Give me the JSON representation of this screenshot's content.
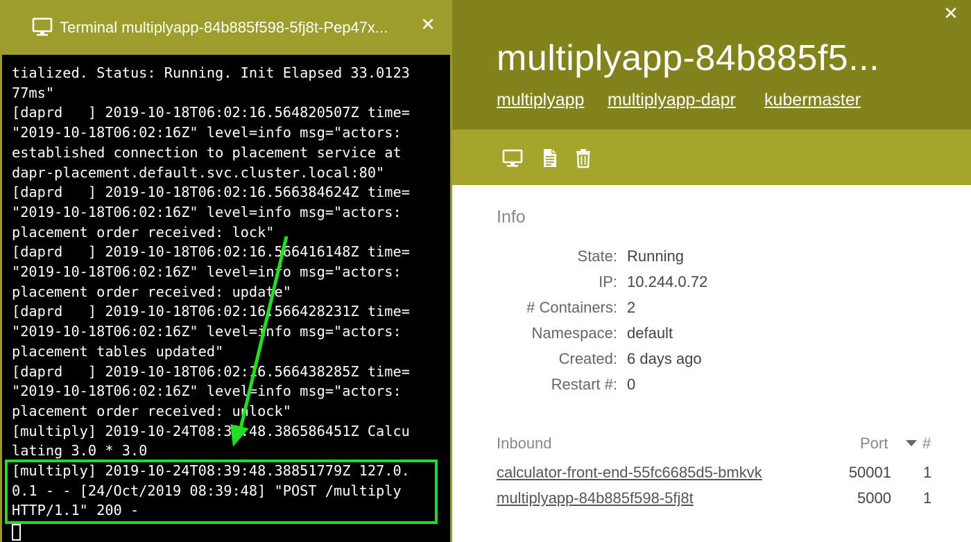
{
  "terminal": {
    "title": "Terminal multiplyapp-84b885f598-5fj8t-Pep47x...",
    "close_label": "✕",
    "lines": [
      "tialized. Status: Running. Init Elapsed 33.0123",
      "77ms\"",
      "[daprd   ] 2019-10-18T06:02:16.564820507Z time=",
      "\"2019-10-18T06:02:16Z\" level=info msg=\"actors:",
      "established connection to placement service at",
      "dapr-placement.default.svc.cluster.local:80\"",
      "[daprd   ] 2019-10-18T06:02:16.566384624Z time=",
      "\"2019-10-18T06:02:16Z\" level=info msg=\"actors:",
      "placement order received: lock\"",
      "[daprd   ] 2019-10-18T06:02:16.566416148Z time=",
      "\"2019-10-18T06:02:16Z\" level=info msg=\"actors:",
      "placement order received: update\"",
      "[daprd   ] 2019-10-18T06:02:16.566428231Z time=",
      "\"2019-10-18T06:02:16Z\" level=info msg=\"actors:",
      "placement tables updated\"",
      "[daprd   ] 2019-10-18T06:02:16.566438285Z time=",
      "\"2019-10-18T06:02:16Z\" level=info msg=\"actors:",
      "placement order received: unlock\"",
      "[multiply] 2019-10-24T08:39:48.386586451Z Calcu",
      "lating 3.0 * 3.0",
      "[multiply] 2019-10-24T08:39:48.38851779Z 127.0.",
      "0.1 - - [24/Oct/2019 08:39:48] \"POST /multiply",
      "HTTP/1.1\" 200 -"
    ]
  },
  "detail": {
    "close_label": "✕",
    "title": "multiplyapp-84b885f5...",
    "links": [
      "multiplyapp",
      "multiplyapp-dapr",
      "kubermaster"
    ],
    "toolbar": {
      "icons": [
        "terminal-icon",
        "logs-document-icon",
        "delete-trash-icon"
      ]
    },
    "info": {
      "heading": "Info",
      "rows": [
        {
          "label": "State:",
          "value": "Running"
        },
        {
          "label": "IP:",
          "value": "10.244.0.72"
        },
        {
          "label": "# Containers:",
          "value": "2"
        },
        {
          "label": "Namespace:",
          "value": "default"
        },
        {
          "label": "Created:",
          "value": "6 days ago"
        },
        {
          "label": "Restart #:",
          "value": "0"
        }
      ]
    },
    "inbound": {
      "heading": "Inbound",
      "port_heading": "Port",
      "count_heading": "#",
      "rows": [
        {
          "name": "calculator-front-end-55fc6685d5-bmkvk",
          "port": "50001",
          "count": "1"
        },
        {
          "name": "multiplyapp-84b885f598-5fj8t",
          "port": "5000",
          "count": "1"
        }
      ]
    }
  },
  "colors": {
    "header_olive": "#83831e",
    "toolbar_olive": "#a5a52b",
    "terminal_titlebar": "#9d9d2b",
    "highlight_green": "#22dd22"
  }
}
